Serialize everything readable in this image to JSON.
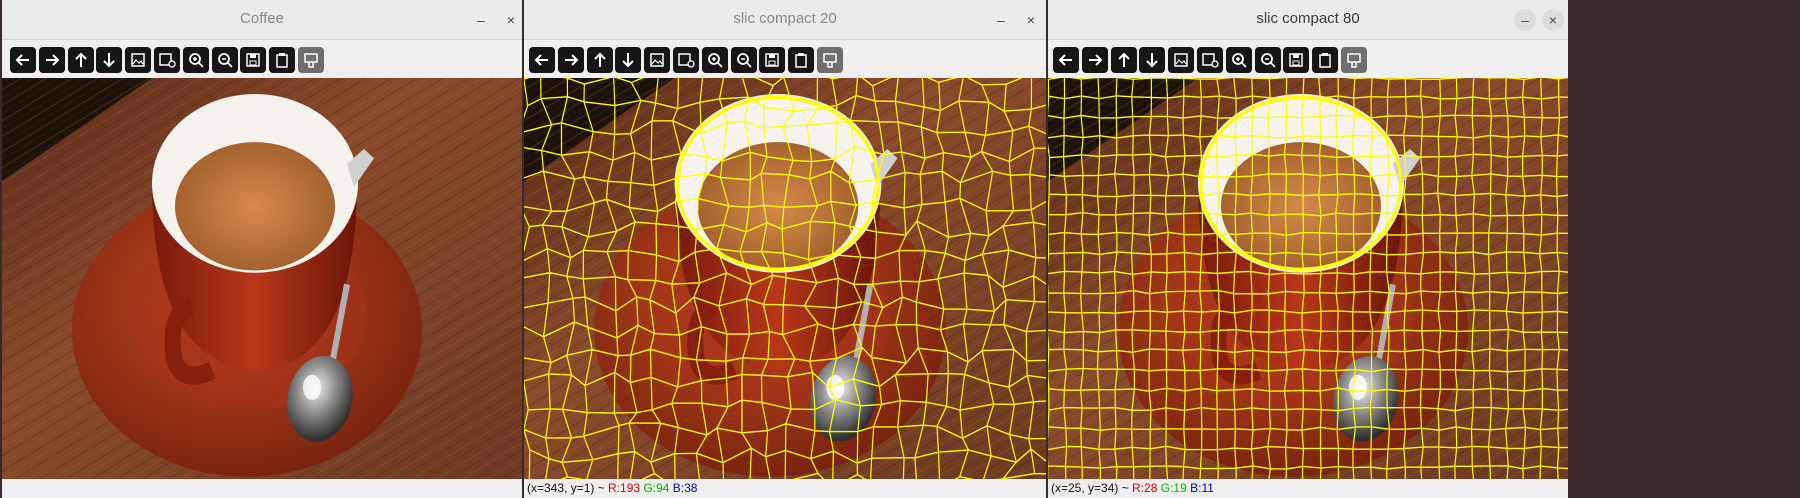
{
  "windows": [
    {
      "title": "Coffee",
      "status": null
    },
    {
      "title": "slic compact 20",
      "status": {
        "coords": "(x=343, y=1) ~ ",
        "r": "R:193",
        "g": "G:94",
        "b": "B:38"
      }
    },
    {
      "title": "slic compact 80",
      "status": {
        "coords": "(x=25, y=34) ~ ",
        "r": "R:28",
        "g": "G:19",
        "b": "B:11"
      }
    }
  ],
  "window_controls": {
    "minimize": "–",
    "close": "×"
  },
  "toolbar_icons": [
    "arrow-left-icon",
    "arrow-right-icon",
    "arrow-up-icon",
    "arrow-down-icon",
    "image-icon",
    "image-info-icon",
    "zoom-in-icon",
    "zoom-out-icon",
    "save-icon",
    "clipboard-icon",
    "properties-icon"
  ],
  "colors": {
    "segment_boundary": "#ffff00",
    "status_r": "#e00000",
    "status_g": "#00b000",
    "status_b": "#0000e0"
  }
}
